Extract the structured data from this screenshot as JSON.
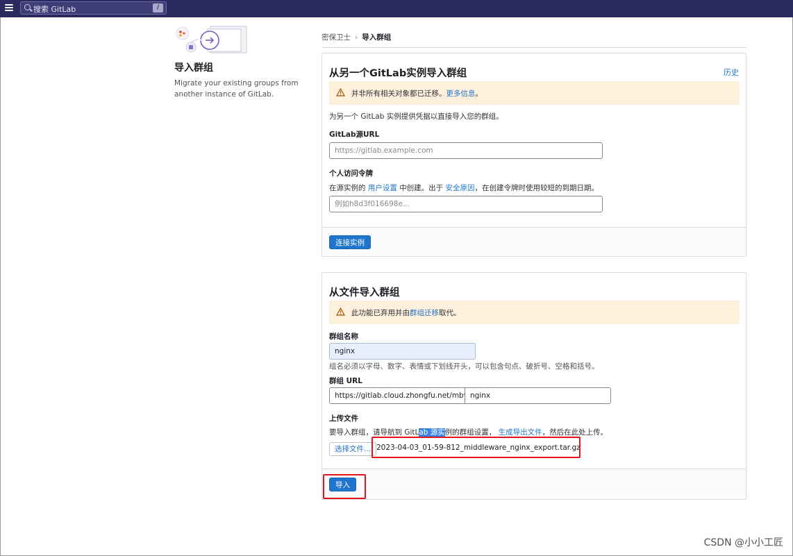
{
  "topbar": {
    "search_placeholder": "搜索 GitLab",
    "search_shortcut": "/"
  },
  "left_panel": {
    "title": "导入群组",
    "description": "Migrate your existing groups from another instance of GitLab."
  },
  "breadcrumb": {
    "parent": "密保卫士",
    "separator": "›",
    "current": "导入群组"
  },
  "instance_import": {
    "title": "从另一个GitLab实例导入群组",
    "history_link": "历史",
    "alert_text": "并非所有相关对象都已迁移。",
    "alert_link": "更多信息",
    "alert_suffix": "。",
    "intro": "为另一个 GitLab 实例提供凭据以直接导入您的群组。",
    "url_label": "GitLab源URL",
    "url_placeholder": "https://gitlab.example.com",
    "token_label": "个人访问令牌",
    "token_help_prefix": "在源实例的",
    "token_help_link1": "用户设置",
    "token_help_mid": "中创建。出于",
    "token_help_link2": "安全原因",
    "token_help_suffix": "，在创建令牌时使用较短的到期日期。",
    "token_placeholder": "例如h8d3f016698e...",
    "connect_button": "连接实例"
  },
  "file_import": {
    "title": "从文件导入群组",
    "alert_text": "此功能已弃用并由",
    "alert_link": "群组迁移",
    "alert_suffix": "取代。",
    "name_label": "群组名称",
    "name_value": "nginx",
    "name_help": "组名必须以字母、数字、表情或下划线开头，可以包含句点、破折号、空格和括号。",
    "url_label": "群组 URL",
    "url_prefix": "https://gitlab.cloud.zhongfu.net/mbws",
    "url_path": "nginx",
    "upload_label": "上传文件",
    "upload_help_1": "要导入群组，请导航到 GitL",
    "upload_help_hl": "ab 源实",
    "upload_help_2": "例的群组设置，",
    "upload_help_link": "生成导出文件",
    "upload_help_3": "，然后在此处上传。",
    "choose_file_button": "选择文件...",
    "file_name": "2023-04-03_01-59-812_middleware_nginx_export.tar.gz",
    "import_button": "导入"
  },
  "watermark": "CSDN @小小工匠",
  "colors": {
    "topbar": "#2b2a5e",
    "link": "#1f75cb",
    "primary": "#1f75cb",
    "alert_bg": "#fdf1dd",
    "highlight_box": "#e3141b"
  }
}
